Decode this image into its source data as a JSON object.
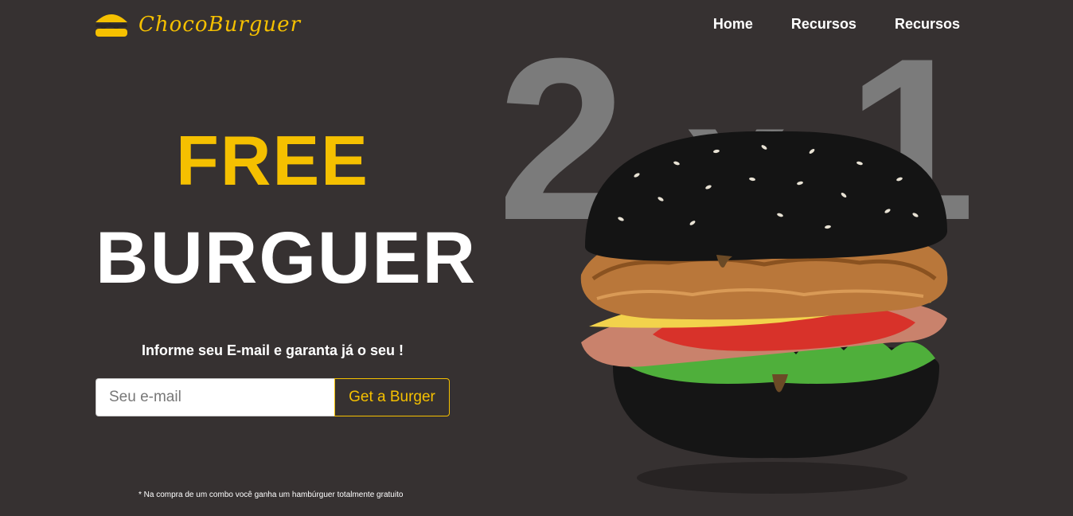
{
  "navbar": {
    "brand_name": "ChocoBurguer",
    "brand_icon": "burger-logo-icon",
    "links": [
      {
        "label": "Home"
      },
      {
        "label": "Recursos"
      },
      {
        "label": "Recursos"
      }
    ]
  },
  "hero": {
    "title_line1": "FREE",
    "title_line2": "BURGUER",
    "lead": "Informe seu E-mail e garanta já o seu !",
    "email_placeholder": "Seu e-mail",
    "cta_label": "Get a Burger",
    "footnote": "* Na compra de um combo você ganha um hambúrguer totalmente gratuito"
  },
  "offer": {
    "left": "2",
    "middle": "x",
    "right": "1"
  },
  "colors": {
    "background": "#363131",
    "accent": "#f5c000",
    "offer_text": "#7b7b7b",
    "text": "#ffffff"
  }
}
